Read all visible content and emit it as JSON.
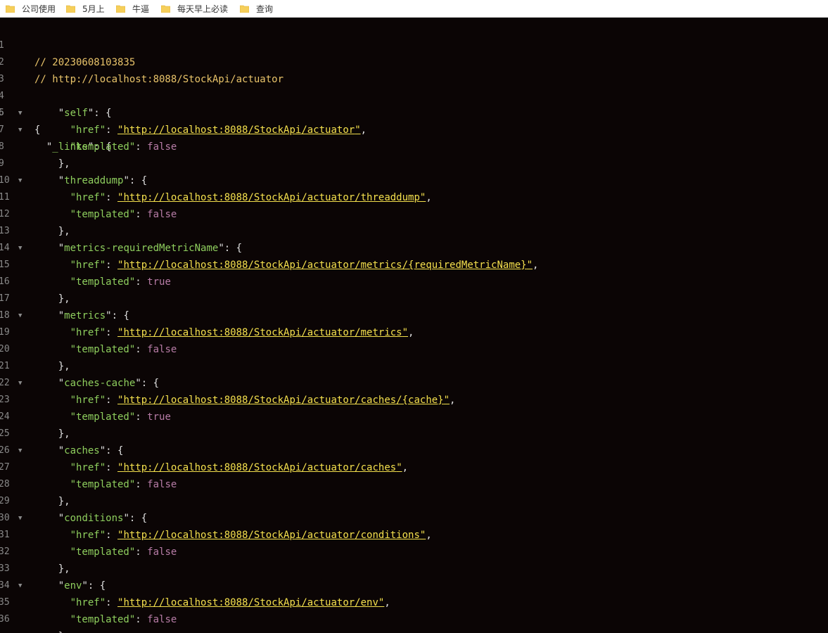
{
  "bookmarks": [
    {
      "label": "公司使用"
    },
    {
      "label": "5月上"
    },
    {
      "label": "牛逼"
    },
    {
      "label": "每天早上必读"
    },
    {
      "label": "查询"
    }
  ],
  "json_view": {
    "comment_timestamp": "// 20230608103835",
    "comment_url": "// http://localhost:8088/StockApi/actuator",
    "root_key": "_links",
    "links": [
      {
        "name": "self",
        "href": "http://localhost:8088/StockApi/actuator",
        "templated": "false"
      },
      {
        "name": "threaddump",
        "href": "http://localhost:8088/StockApi/actuator/threaddump",
        "templated": "false"
      },
      {
        "name": "metrics-requiredMetricName",
        "href": "http://localhost:8088/StockApi/actuator/metrics/{requiredMetricName}",
        "templated": "true"
      },
      {
        "name": "metrics",
        "href": "http://localhost:8088/StockApi/actuator/metrics",
        "templated": "false"
      },
      {
        "name": "caches-cache",
        "href": "http://localhost:8088/StockApi/actuator/caches/{cache}",
        "templated": "true"
      },
      {
        "name": "caches",
        "href": "http://localhost:8088/StockApi/actuator/caches",
        "templated": "false"
      },
      {
        "name": "conditions",
        "href": "http://localhost:8088/StockApi/actuator/conditions",
        "templated": "false"
      },
      {
        "name": "env",
        "href": "http://localhost:8088/StockApi/actuator/env",
        "templated": "false"
      }
    ],
    "line_numbers": [
      "1",
      "2",
      "3",
      "4",
      "5",
      "6",
      "7",
      "8",
      "9",
      "10",
      "11",
      "12",
      "13",
      "14",
      "15",
      "16",
      "17",
      "18",
      "19",
      "20",
      "21",
      "22",
      "23",
      "24",
      "25",
      "26",
      "27",
      "28",
      "29",
      "30",
      "31",
      "32",
      "33",
      "34",
      "35",
      "36"
    ],
    "fold_glyph": "▼"
  },
  "colors": {
    "background": "#0b0505",
    "key": "#8fcf5e",
    "url": "#f4e04d",
    "bool": "#b77ca6",
    "comment": "#e9c46a"
  }
}
